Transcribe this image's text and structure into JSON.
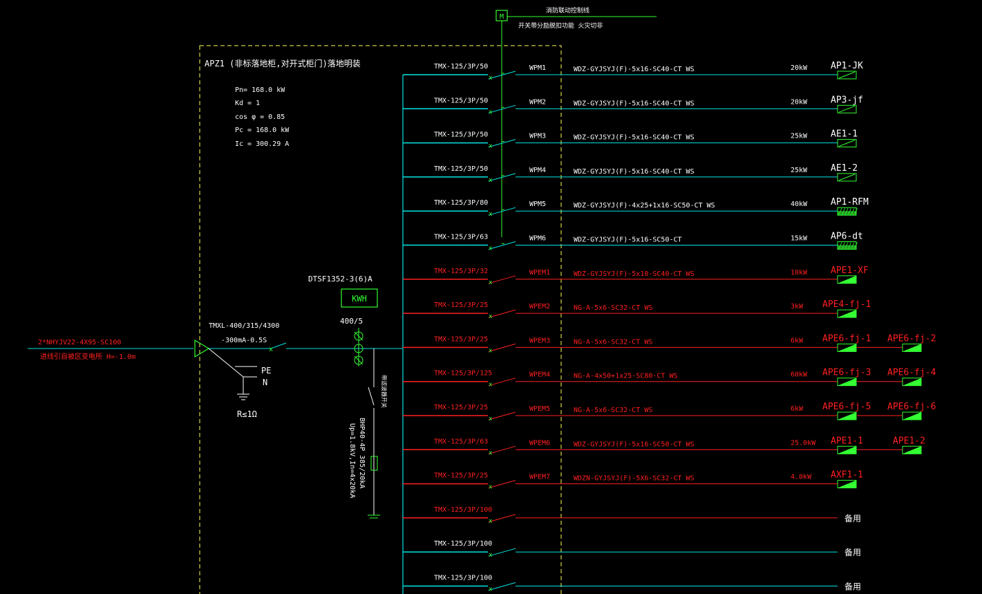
{
  "colors": {
    "background": "#000000",
    "normal": "#00e5e5",
    "fire": "#ff2020",
    "text": "#ffffff",
    "control": "#33ff33",
    "box": "#ffff55"
  },
  "control": {
    "module": "M",
    "line_label": "消防联动控制线",
    "func_label": "开关带分励脱扣功能   火灾切非"
  },
  "panel": {
    "title": "APZ1 (非标落地柜,对开式柜门)落地明装",
    "params": [
      "Pn=  168.0      kW",
      "Kd  =  1",
      "cos φ  = 0.85",
      "Pc  =  168.0      kW",
      "Ic  =  300.29     A"
    ]
  },
  "incoming": {
    "cable": "2*NHYJV22-4X95-SC100",
    "note": "进线引自被区变电所   H=-1.0m",
    "main_breaker": [
      "TMXL-400/315/4300",
      "-300mA-0.5S"
    ],
    "pe": "PE",
    "n": "N",
    "ground": "R≤1Ω",
    "meter_model": "DTSF1352-3(6)A",
    "meter": "KWH",
    "ct": "400/5",
    "spd_switch": "带滤波器开关",
    "spd": [
      "BHP40-4P 385/20kA",
      "Up=1.8kV,In=4x20kA"
    ]
  },
  "circuits": [
    {
      "breaker": "TMX-125/3P/50",
      "circuit": "WPM1",
      "cable": "WDZ-GYJSYJ(F)-5x16-SC40-CT WS",
      "load": "20kW",
      "targets": [
        "AP1-JK"
      ],
      "fire": false,
      "symbol": "normal"
    },
    {
      "breaker": "TMX-125/3P/50",
      "circuit": "WPM2",
      "cable": "WDZ-GYJSYJ(F)-5x16-SC40-CT WS",
      "load": "20kW",
      "targets": [
        "AP3-jf"
      ],
      "fire": false,
      "symbol": "normal"
    },
    {
      "breaker": "TMX-125/3P/50",
      "circuit": "WPM3",
      "cable": "WDZ-GYJSYJ(F)-5x16-SC40-CT WS",
      "load": "25kW",
      "targets": [
        "AE1-1"
      ],
      "fire": false,
      "symbol": "normal"
    },
    {
      "breaker": "TMX-125/3P/50",
      "circuit": "WPM4",
      "cable": "WDZ-GYJSYJ(F)-5x16-SC40-CT WS",
      "load": "25kW",
      "targets": [
        "AE1-2"
      ],
      "fire": false,
      "symbol": "normal"
    },
    {
      "breaker": "TMX-125/3P/80",
      "circuit": "WPM5",
      "cable": "WDZ-GYJSYJ(F)-4x25+1x16-SC50-CT WS",
      "load": "40kW",
      "targets": [
        "AP1-RFM"
      ],
      "fire": false,
      "symbol": "hatched"
    },
    {
      "breaker": "TMX-125/3P/63",
      "circuit": "WPM6",
      "cable": "WDZ-GYJSYJ(F)-5x16-SC50-CT",
      "load": "15kW",
      "targets": [
        "AP6-dt"
      ],
      "fire": false,
      "symbol": "hatched"
    },
    {
      "breaker": "TMX-125/3P/32",
      "circuit": "WPEM1",
      "cable": "WDZ-GYJSYJ(F)-5x10-SC40-CT WS",
      "load": "10kW",
      "targets": [
        "APE1-XF"
      ],
      "fire": true,
      "symbol": "fire"
    },
    {
      "breaker": "TMX-125/3P/25",
      "circuit": "WPEM2",
      "cable": "NG-A-5x6-SC32-CT WS",
      "load": "3kW",
      "targets": [
        "APE4-fj-1"
      ],
      "fire": true,
      "symbol": "fire"
    },
    {
      "breaker": "TMX-125/3P/25",
      "circuit": "WPEM3",
      "cable": "NG-A-5x6-SC32-CT WS",
      "load": "6kW",
      "targets": [
        "APE6-fj-1",
        "APE6-fj-2"
      ],
      "fire": true,
      "symbol": "fire"
    },
    {
      "breaker": "TMX-125/3P/125",
      "circuit": "WPEM4",
      "cable": "NG-A-4x50+1x25-SC80-CT WS",
      "load": "60kW",
      "targets": [
        "APE6-fj-3",
        "APE6-fj-4"
      ],
      "fire": true,
      "symbol": "fire"
    },
    {
      "breaker": "TMX-125/3P/25",
      "circuit": "WPEM5",
      "cable": "NG-A-5x6-SC32-CT WS",
      "load": "6kW",
      "targets": [
        "APE6-fj-5",
        "APE6-fj-6"
      ],
      "fire": true,
      "symbol": "fire"
    },
    {
      "breaker": "TMX-125/3P/63",
      "circuit": "WPEM6",
      "cable": "WDZ-GYJSYJ(F)-5x16-SC50-CT WS",
      "load": "25.0kW",
      "targets": [
        "APE1-1",
        "APE1-2"
      ],
      "fire": true,
      "symbol": "fire"
    },
    {
      "breaker": "TMX-125/3P/25",
      "circuit": "WPEM7",
      "cable": "WDZN-GYJSYJ(F)-5X6-SC32-CT WS",
      "load": "4.0kW",
      "targets": [
        "AXF1-1"
      ],
      "fire": true,
      "symbol": "fire"
    },
    {
      "breaker": "TMX-125/3P/100",
      "circuit": "",
      "cable": "",
      "load": "",
      "targets": [],
      "spare": "备用",
      "fire": true,
      "symbol": "none"
    },
    {
      "breaker": "TMX-125/3P/100",
      "circuit": "",
      "cable": "",
      "load": "",
      "targets": [],
      "spare": "备用",
      "fire": false,
      "symbol": "none"
    },
    {
      "breaker": "TMX-125/3P/100",
      "circuit": "",
      "cable": "",
      "load": "",
      "targets": [],
      "spare": "备用",
      "fire": false,
      "symbol": "none"
    }
  ]
}
